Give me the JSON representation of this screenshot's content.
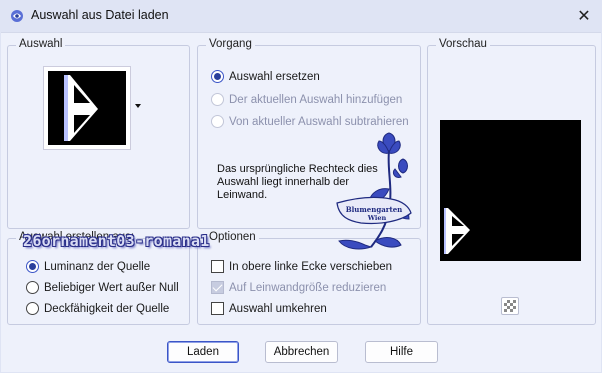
{
  "window": {
    "title": "Auswahl aus Datei laden",
    "close_glyph": "✕"
  },
  "groups": {
    "auswahl": {
      "label": "Auswahl"
    },
    "vorgang": {
      "label": "Vorgang",
      "options": [
        {
          "label": "Auswahl ersetzen",
          "checked": true,
          "disabled": false
        },
        {
          "label": "Der aktuellen Auswahl hinzufügen",
          "checked": false,
          "disabled": true
        },
        {
          "label": "Von aktueller Auswahl subtrahieren",
          "checked": false,
          "disabled": true
        }
      ],
      "info_lines": [
        "Das ursprüngliche Rechteck dies",
        "Auswahl liegt innerhalb der",
        "Leinwand."
      ]
    },
    "vorschau": {
      "label": "Vorschau",
      "zoom_icon": "checkerboard-icon"
    },
    "auswahl_erstellen": {
      "label": "Auswahl erstellen aus:",
      "options": [
        {
          "label": "Luminanz der Quelle",
          "checked": true
        },
        {
          "label": "Beliebiger Wert außer Null",
          "checked": false
        },
        {
          "label": "Deckfähigkeit der Quelle",
          "checked": false
        }
      ]
    },
    "optionen": {
      "label": "Optionen",
      "checks": [
        {
          "label": "In obere linke Ecke verschieben",
          "checked": false,
          "disabled": false
        },
        {
          "label": "Auf Leinwandgröße reduzieren",
          "checked": true,
          "disabled": true
        },
        {
          "label": "Auswahl umkehren",
          "checked": false,
          "disabled": false
        }
      ]
    }
  },
  "watermark": {
    "text": "26ornament03-romana1",
    "stamp_lines": [
      "Blumengarten",
      "Wien"
    ]
  },
  "buttons": {
    "load": "Laden",
    "cancel": "Abbrechen",
    "help": "Hilfe"
  },
  "colors": {
    "accent": "#3b55c7",
    "window_bg": "#eef1fb",
    "titlebar_bg": "#dfe4f4",
    "preview_bg": "#000000"
  }
}
